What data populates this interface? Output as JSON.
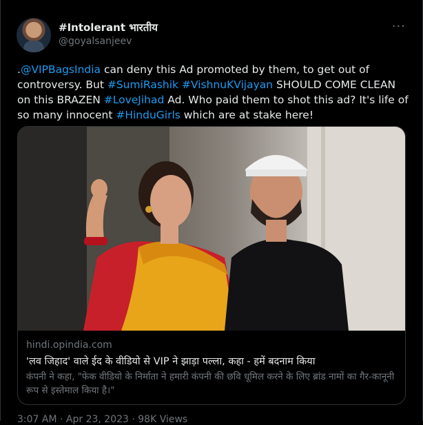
{
  "author": {
    "name": "#Intolerant भारतीय",
    "handle": "@goyalsanjeev"
  },
  "more_icon": "more-horizontal-icon",
  "tweet_text": {
    "prefix": ".",
    "mention": "@VIPBagsIndia",
    "part1": " can deny this Ad promoted by them, to get out of controversy. But ",
    "hashtag1": "#SumiRashik",
    "space1": " ",
    "hashtag2": "#VishnuKVijayan",
    "part2": " SHOULD COME CLEAN on this BRAZEN ",
    "hashtag3": "#LoveJihad",
    "part3": " Ad. Who paid them to shot this ad? It's life of so many innocent ",
    "hashtag4": "#HinduGirls",
    "part4": " which are at stake here!"
  },
  "card": {
    "domain": "hindi.opindia.com",
    "title": "'लव जिहाद' वाले ईद के वीडियो से VIP ने झाड़ा पल्ला, कहा - हमें बदनाम किया",
    "description": "कंपनी ने कहा, \"फेक वीडियो के निर्माता ने हमारी कंपनी की छवि धूमिल करने के लिए ब्रांड नामों का गैर-कानूनी रूप से इस्तेमाल किया है।\""
  },
  "footer": "3:07 AM · Apr 23, 2023 · 98K Views",
  "colors": {
    "background": "#000000",
    "text": "#e7e9ea",
    "link": "#1d9bf0",
    "muted": "#71767b",
    "border": "#2f3336"
  }
}
